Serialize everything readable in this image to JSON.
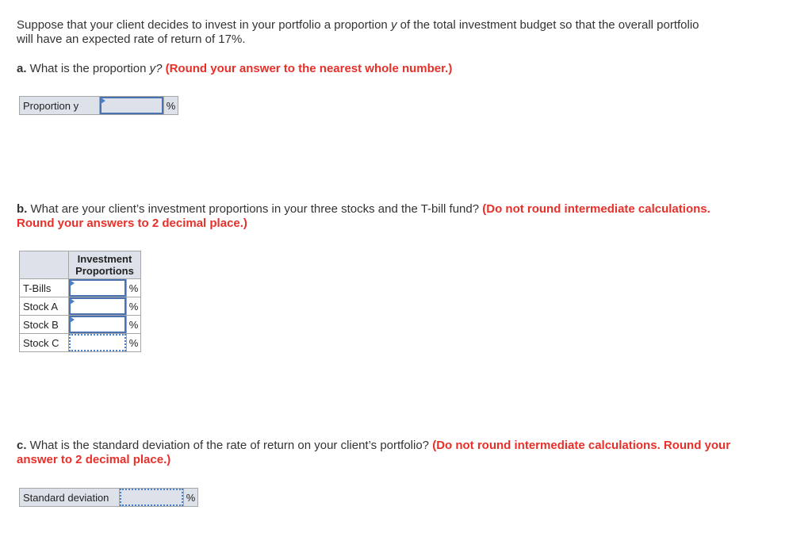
{
  "intro": {
    "line1_a": "Suppose that your client decides to invest in your portfolio a proportion ",
    "line1_var": "y",
    "line1_b": " of the total investment budget so that the overall portfolio",
    "line2": "will have an expected rate of return of 17%."
  },
  "part_a": {
    "letter": "a.",
    "question_a": " What is the proportion ",
    "question_var": "y?",
    "instruction": " (Round your answer to the nearest whole number.)",
    "row_label": "Proportion y",
    "value": "",
    "unit": "%"
  },
  "part_b": {
    "letter": "b.",
    "question": " What are your client’s investment proportions in your three stocks and the T-bill fund? ",
    "instruction_1": "(Do not round intermediate calculations.",
    "instruction_2": "Round your answers to 2 decimal place.)",
    "column_header_1": "Investment",
    "column_header_2": "Proportions",
    "rows": [
      {
        "label": "T-Bills",
        "value": "",
        "unit": "%"
      },
      {
        "label": "Stock A",
        "value": "",
        "unit": "%"
      },
      {
        "label": "Stock B",
        "value": "",
        "unit": "%"
      },
      {
        "label": "Stock C",
        "value": "",
        "unit": "%"
      }
    ]
  },
  "part_c": {
    "letter": "c.",
    "question": " What is the standard deviation of the rate of return on your client’s portfolio? ",
    "instruction_1": "(Do not round intermediate calculations. Round your",
    "instruction_2": "answer to 2 decimal place.)",
    "row_label": "Standard deviation",
    "value": "",
    "unit": "%"
  }
}
